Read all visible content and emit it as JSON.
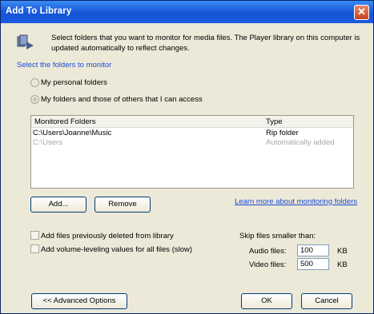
{
  "window": {
    "title": "Add To Library",
    "close_glyph": "✕"
  },
  "intro": {
    "text": "Select folders that you want to monitor for media files. The Player library on this computer is updated automatically to reflect changes.",
    "icon": "library-icon"
  },
  "section": {
    "label": "Select the folders to monitor"
  },
  "radios": [
    {
      "label": "My personal folders",
      "checked": false
    },
    {
      "label": "My folders and those of others that I can access",
      "checked": true
    }
  ],
  "folders_list": {
    "headers": {
      "folder": "Monitored Folders",
      "type": "Type"
    },
    "rows": [
      {
        "folder": "C:\\Users\\Joanne\\Music",
        "type": "Rip folder",
        "enabled": true
      },
      {
        "folder": "C:\\Users",
        "type": "Automatically added",
        "enabled": false
      }
    ]
  },
  "buttons": {
    "add": "Add...",
    "remove": "Remove",
    "learn_more": "Learn more about monitoring folders",
    "advanced": "<< Advanced Options",
    "ok": "OK",
    "cancel": "Cancel"
  },
  "options": {
    "deleted": "Add files previously deleted from library",
    "volume": "Add volume-leveling values for all files (slow)"
  },
  "skip": {
    "title": "Skip files smaller than:",
    "audio_label": "Audio files:",
    "audio_value": "100",
    "video_label": "Video files:",
    "video_value": "500",
    "unit": "KB"
  },
  "colors": {
    "link": "#1c4ad6",
    "disabled_text": "#a8a8a0",
    "titlebar": "#1f61de"
  }
}
